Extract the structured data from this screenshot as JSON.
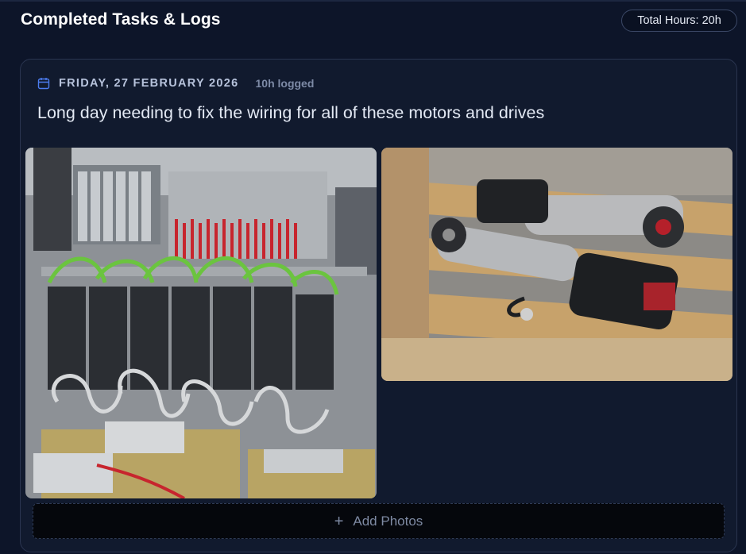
{
  "section": {
    "title": "Completed Tasks & Logs",
    "total_hours": "Total Hours: 20h"
  },
  "log": {
    "date": "FRIDAY, 27 FEBRUARY 2026",
    "hours_logged": "10h logged",
    "description": "Long day needing to fix the wiring for all of these motors and drives",
    "photos": [
      {
        "name": "control-cabinet-photo",
        "subject": "electrical control cabinet with servo drives and wiring"
      },
      {
        "name": "pump-motors-photo",
        "subject": "two pump motors on a wooden pallet"
      }
    ],
    "add_photos_label": "Add Photos"
  },
  "icons": {
    "calendar": "calendar-icon",
    "plus": "plus-icon"
  },
  "colors": {
    "background": "#0d1529",
    "card": "#111a2e",
    "accent_blue": "#4c7df0"
  }
}
